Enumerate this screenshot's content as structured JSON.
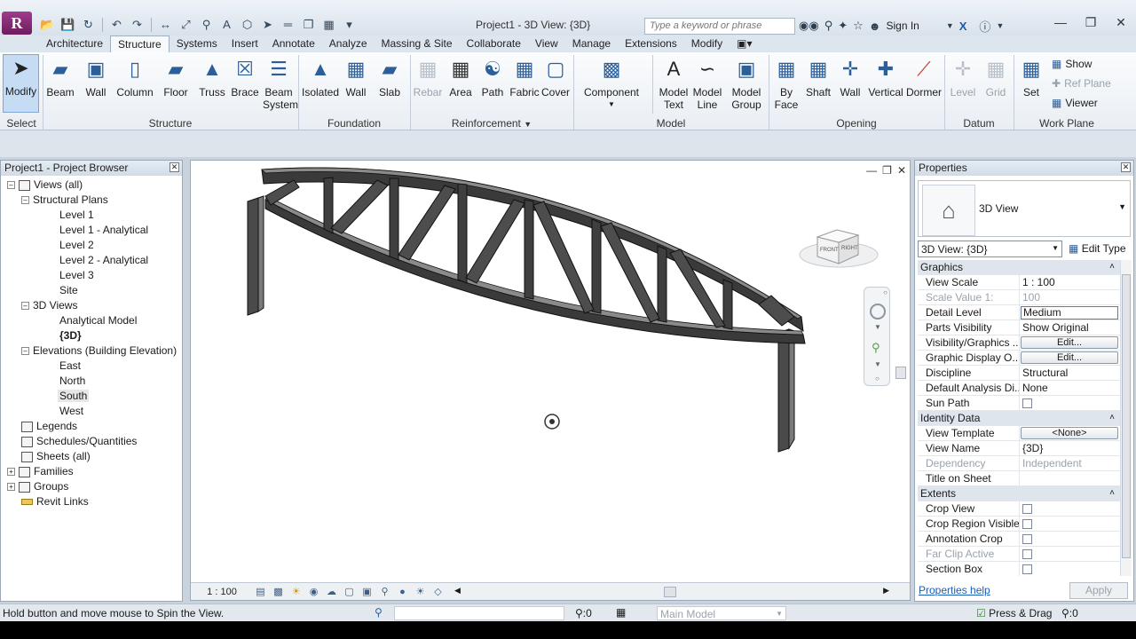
{
  "app": {
    "window_title": "Project1 - 3D View: {3D}",
    "search_placeholder": "Type a keyword or phrase",
    "sign_in": "Sign In"
  },
  "tabs": [
    "Architecture",
    "Structure",
    "Systems",
    "Insert",
    "Annotate",
    "Analyze",
    "Massing & Site",
    "Collaborate",
    "View",
    "Manage",
    "Extensions",
    "Modify"
  ],
  "active_tab": "Structure",
  "ribbon": {
    "select": {
      "modify": "Modify",
      "panel": "Select"
    },
    "structure": {
      "beam": "Beam",
      "wall": "Wall",
      "column": "Column",
      "floor": "Floor",
      "truss": "Truss",
      "brace": "Brace",
      "beam_system_1": "Beam",
      "beam_system_2": "System",
      "panel": "Structure"
    },
    "foundation": {
      "isolated": "Isolated",
      "wall": "Wall",
      "slab": "Slab",
      "panel": "Foundation"
    },
    "reinforcement": {
      "rebar": "Rebar",
      "area": "Area",
      "path": "Path",
      "fabric": "Fabric",
      "cover": "Cover",
      "panel": "Reinforcement"
    },
    "model": {
      "component": "Component",
      "model_text_1": "Model",
      "model_text_2": "Text",
      "model_line_1": "Model",
      "model_line_2": "Line",
      "model_group_1": "Model",
      "model_group_2": "Group",
      "panel": "Model"
    },
    "opening": {
      "by_face_1": "By",
      "by_face_2": "Face",
      "shaft": "Shaft",
      "wall": "Wall",
      "vertical": "Vertical",
      "dormer": "Dormer",
      "panel": "Opening"
    },
    "datum": {
      "level": "Level",
      "grid": "Grid",
      "panel": "Datum"
    },
    "work_plane": {
      "set": "Set",
      "show": "Show",
      "ref_plane": "Ref Plane",
      "viewer": "Viewer",
      "panel": "Work Plane"
    }
  },
  "browser": {
    "title": "Project1 - Project Browser",
    "items": [
      {
        "label": "Views (all)"
      },
      {
        "label": "Structural Plans"
      },
      {
        "label": "Level 1"
      },
      {
        "label": "Level 1 - Analytical"
      },
      {
        "label": "Level 2"
      },
      {
        "label": "Level 2 - Analytical"
      },
      {
        "label": "Level 3"
      },
      {
        "label": "Site"
      },
      {
        "label": "3D Views"
      },
      {
        "label": "Analytical Model"
      },
      {
        "label": "{3D}"
      },
      {
        "label": "Elevations (Building Elevation)"
      },
      {
        "label": "East"
      },
      {
        "label": "North"
      },
      {
        "label": "South"
      },
      {
        "label": "West"
      },
      {
        "label": "Legends"
      },
      {
        "label": "Schedules/Quantities"
      },
      {
        "label": "Sheets (all)"
      },
      {
        "label": "Families"
      },
      {
        "label": "Groups"
      },
      {
        "label": "Revit Links"
      }
    ]
  },
  "view": {
    "scale": "1 : 100",
    "viewcube_front": "FRONT",
    "viewcube_right": "RIGHT"
  },
  "properties": {
    "title": "Properties",
    "type_name": "3D View",
    "instance_selector": "3D View: {3D}",
    "edit_type": "Edit Type",
    "rows": [
      {
        "name": "Graphics",
        "group": true
      },
      {
        "name": "View Scale",
        "value": "1 : 100"
      },
      {
        "name": "Scale Value    1:",
        "value": "100"
      },
      {
        "name": "Detail Level",
        "value": "Medium"
      },
      {
        "name": "Parts Visibility",
        "value": "Show Original"
      },
      {
        "name": "Visibility/Graphics ...",
        "value": "Edit..."
      },
      {
        "name": "Graphic Display O...",
        "value": "Edit..."
      },
      {
        "name": "Discipline",
        "value": "Structural"
      },
      {
        "name": "Default Analysis Di...",
        "value": "None"
      },
      {
        "name": "Sun Path",
        "value": ""
      },
      {
        "name": "Identity Data",
        "group": true
      },
      {
        "name": "View Template",
        "value": "<None>"
      },
      {
        "name": "View Name",
        "value": "{3D}"
      },
      {
        "name": "Dependency",
        "value": "Independent"
      },
      {
        "name": "Title on Sheet",
        "value": ""
      },
      {
        "name": "Extents",
        "group": true
      },
      {
        "name": "Crop View",
        "value": ""
      },
      {
        "name": "Crop Region Visible",
        "value": ""
      },
      {
        "name": "Annotation Crop",
        "value": ""
      },
      {
        "name": "Far Clip Active",
        "value": ""
      },
      {
        "name": "Section Box",
        "value": ""
      }
    ],
    "help": "Properties help",
    "apply": "Apply"
  },
  "status": {
    "message": "Hold button and move mouse to Spin the View.",
    "count": ":0",
    "model": "Main Model",
    "press_drag": "Press & Drag",
    "filter": ":0"
  }
}
